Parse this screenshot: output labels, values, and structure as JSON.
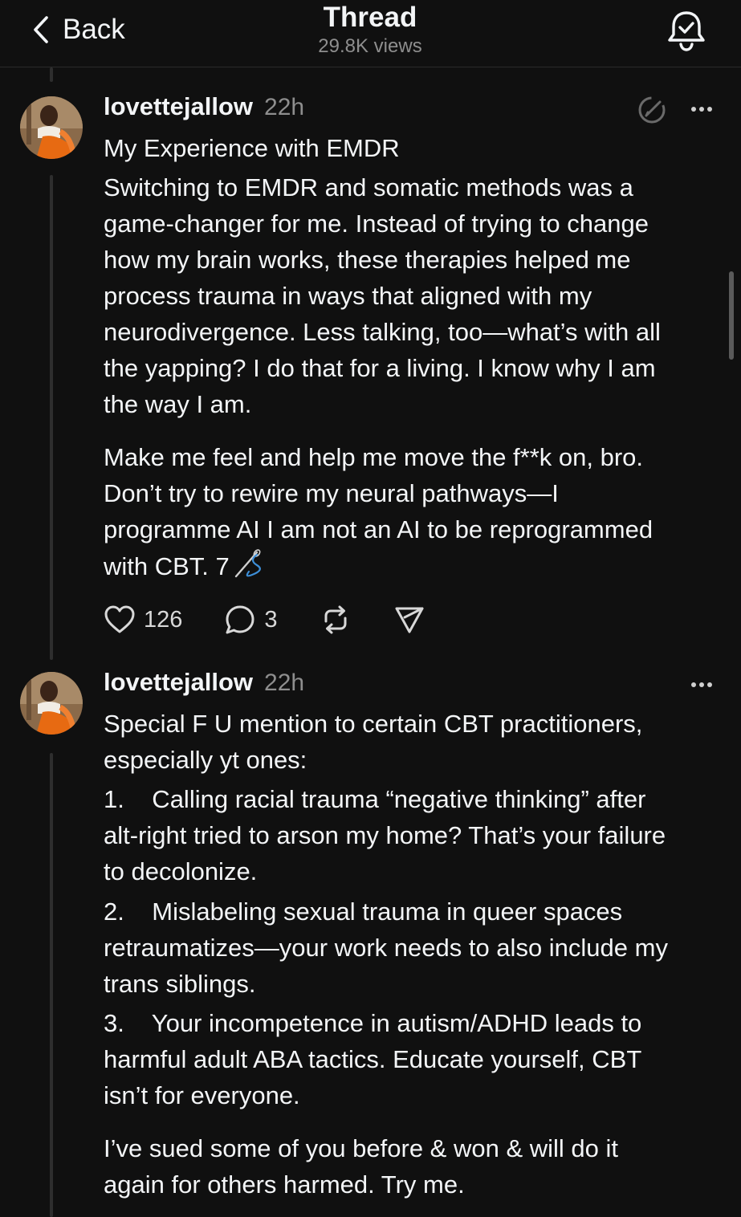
{
  "header": {
    "back_label": "Back",
    "title": "Thread",
    "views": "29.8K views"
  },
  "posts": [
    {
      "username": "lovettejallow",
      "time": "22h",
      "title": "My Experience with EMDR",
      "paragraphs": [
        "Switching to EMDR and somatic methods was a\ngame-changer for me. Instead of trying to change\nhow my brain works, these therapies helped me\nprocess trauma in ways that aligned with my\nneurodivergence. Less talking, too—what’s with all\nthe yapping? I do that for a living. I know why I am\nthe way I am.",
        "Make me feel and help me move the f**k on, bro.\nDon’t try to rewire my neural pathways—I\nprogramme AI I am not an AI to be reprogrammed\nwith CBT. 7"
      ],
      "trailing_emoji": "🪡",
      "actions": {
        "likes": "126",
        "replies": "3"
      }
    },
    {
      "username": "lovettejallow",
      "time": "22h",
      "text": "Special F U mention to certain CBT practitioners,\nespecially yt ones:",
      "items": [
        "1.    Calling racial trauma “negative thinking” after\nalt-right tried to arson my home? That’s your failure\nto decolonize.",
        "2.    Mislabeling sexual trauma in queer spaces\nretraumatizes—your work needs to also include my\ntrans siblings.",
        "3.    Your incompetence in autism/ADHD leads to\nharmful adult ABA tactics. Educate yourself, CBT\nisn’t for everyone."
      ],
      "closing": "I’ve sued some of you before & won & will do it\nagain for others harmed. Try me."
    }
  ],
  "colors": {
    "background": "#101010",
    "text": "#f3f5f7",
    "secondary": "#8e8e8e",
    "thread_line": "#2e2e2e"
  }
}
